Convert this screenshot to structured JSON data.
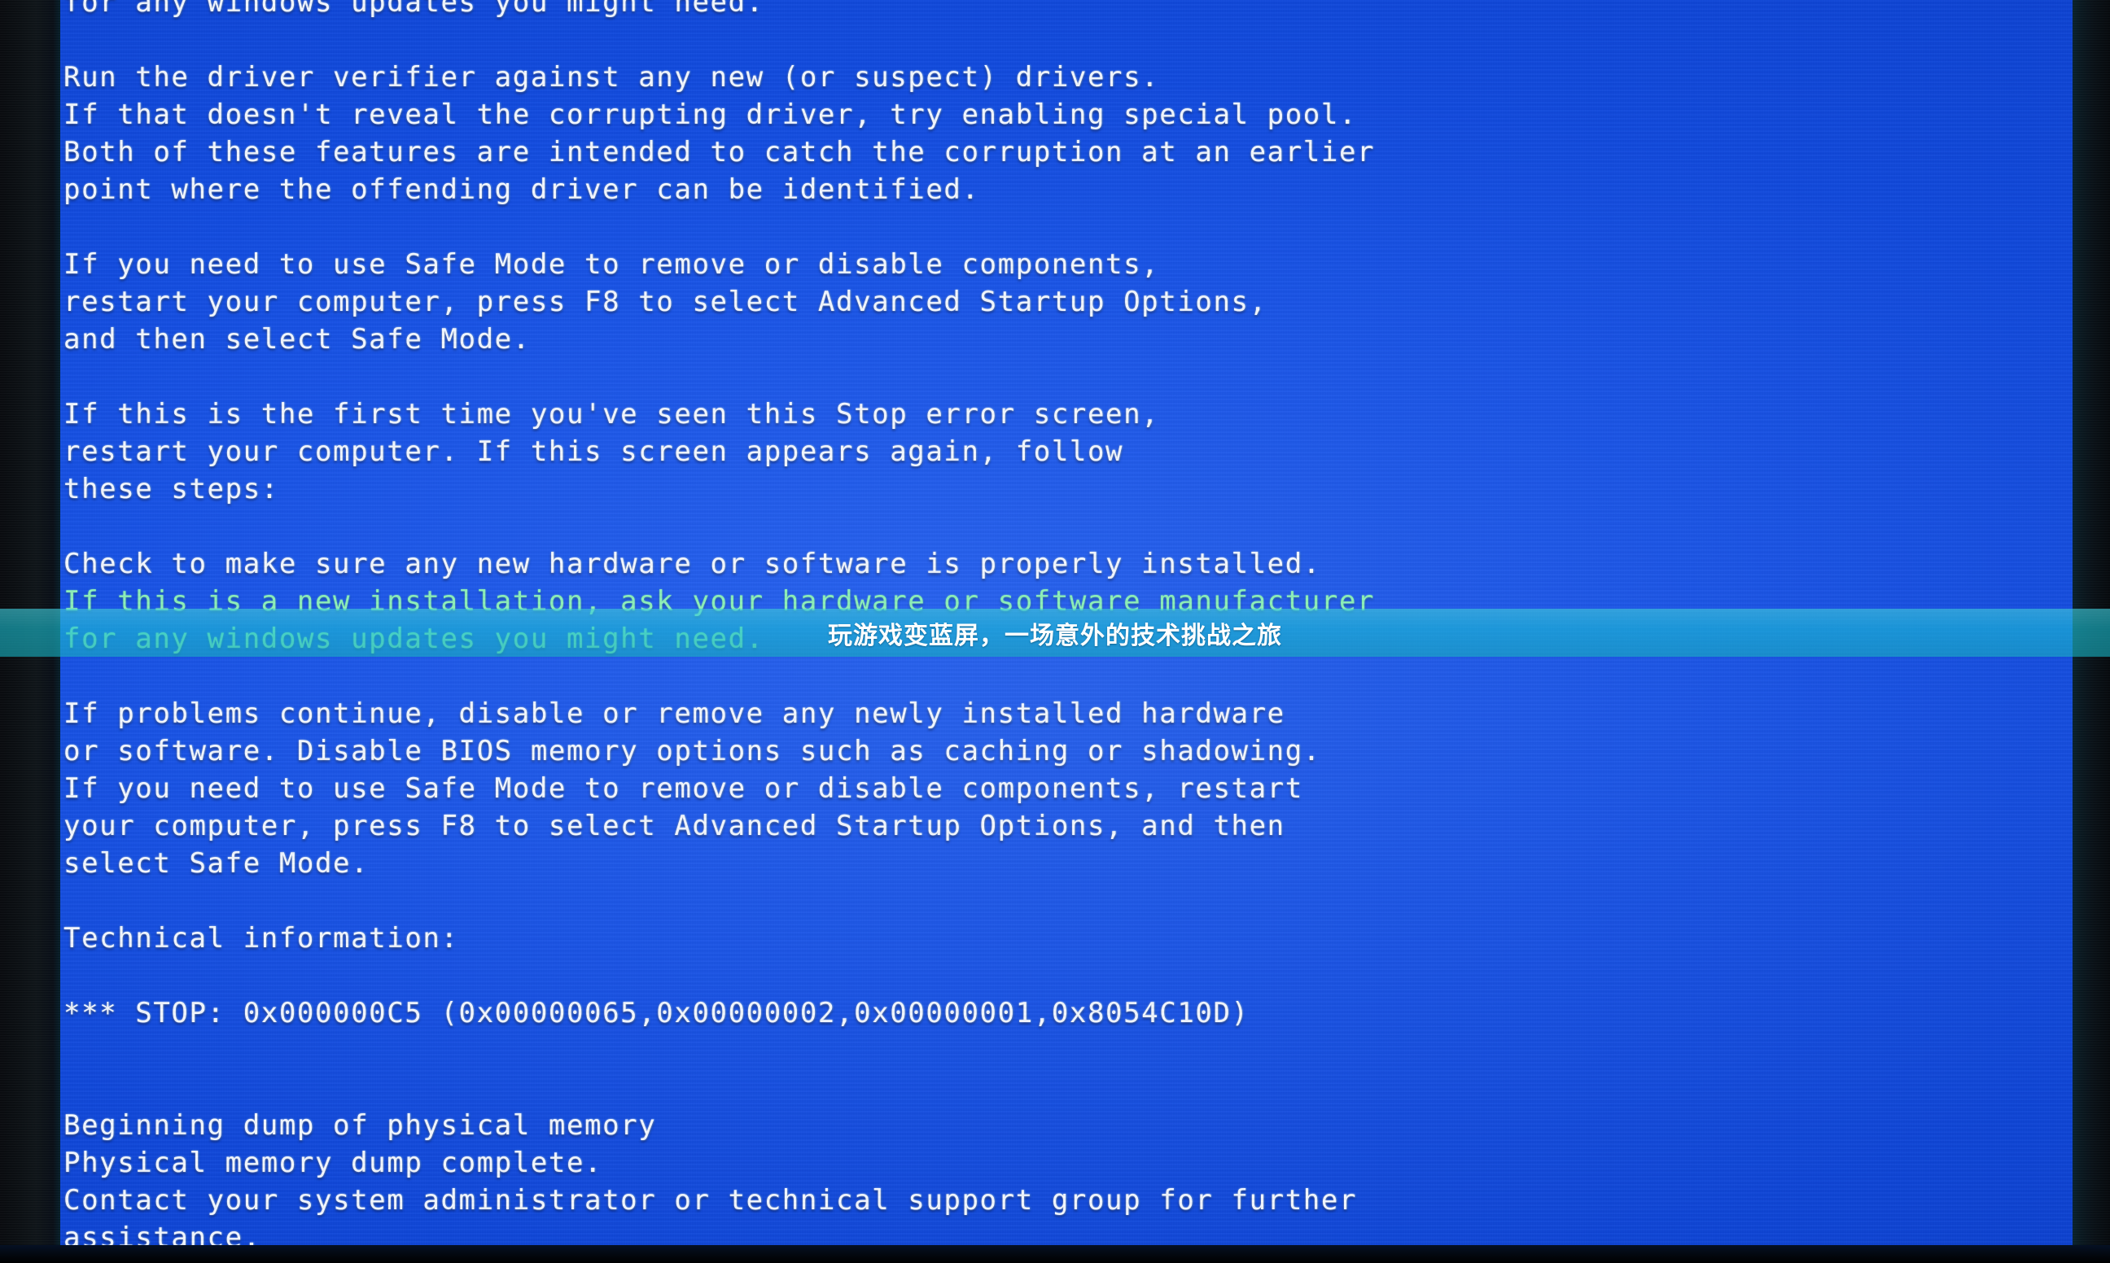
{
  "screen": {
    "type": "windows-bsod",
    "background_color": "#1050E6",
    "text_color": "#F2F7FF",
    "lines": [
      "for any windows updates you might need.",
      "",
      "Run the driver verifier against any new (or suspect) drivers.",
      "If that doesn't reveal the corrupting driver, try enabling special pool.",
      "Both of these features are intended to catch the corruption at an earlier",
      "point where the offending driver can be identified.",
      "",
      "If you need to use Safe Mode to remove or disable components,",
      "restart your computer, press F8 to select Advanced Startup Options,",
      "and then select Safe Mode.",
      "",
      "If this is the first time you've seen this Stop error screen,",
      "restart your computer. If this screen appears again, follow",
      "these steps:",
      "",
      "Check to make sure any new hardware or software is properly installed.",
      "If this is a new installation, ask your hardware or software manufacturer",
      "for any windows updates you might need.",
      "",
      "If problems continue, disable or remove any newly installed hardware",
      "or software. Disable BIOS memory options such as caching or shadowing.",
      "If you need to use Safe Mode to remove or disable components, restart",
      "your computer, press F8 to select Advanced Startup Options, and then",
      "select Safe Mode.",
      "",
      "Technical information:",
      "",
      "*** STOP: 0x000000C5 (0x00000065,0x00000002,0x00000001,0x8054C10D)",
      "",
      "",
      "Beginning dump of physical memory",
      "Physical memory dump complete.",
      "Contact your system administrator or technical support group for further",
      "assistance."
    ],
    "technical_information": {
      "heading": "Technical information:",
      "stop_code": "0x000000C5",
      "parameters": [
        "0x00000065",
        "0x00000002",
        "0x00000001",
        "0x8054C10D"
      ],
      "full_stop_line": "*** STOP: 0x000000C5 (0x00000065,0x00000002,0x00000001,0x8054C10D)"
    },
    "dump_status": {
      "beginning": "Beginning dump of physical memory",
      "complete": "Physical memory dump complete."
    }
  },
  "overlay": {
    "title": "玩游戏变蓝屏，一场意外的技术挑战之旅",
    "band_color": "#1AC0D2",
    "band_text_color": "#FFFFFF"
  },
  "bezel": {
    "left_color": "#0C1014",
    "right_color": "#0A1A22",
    "bottom_color": "#03080F"
  }
}
